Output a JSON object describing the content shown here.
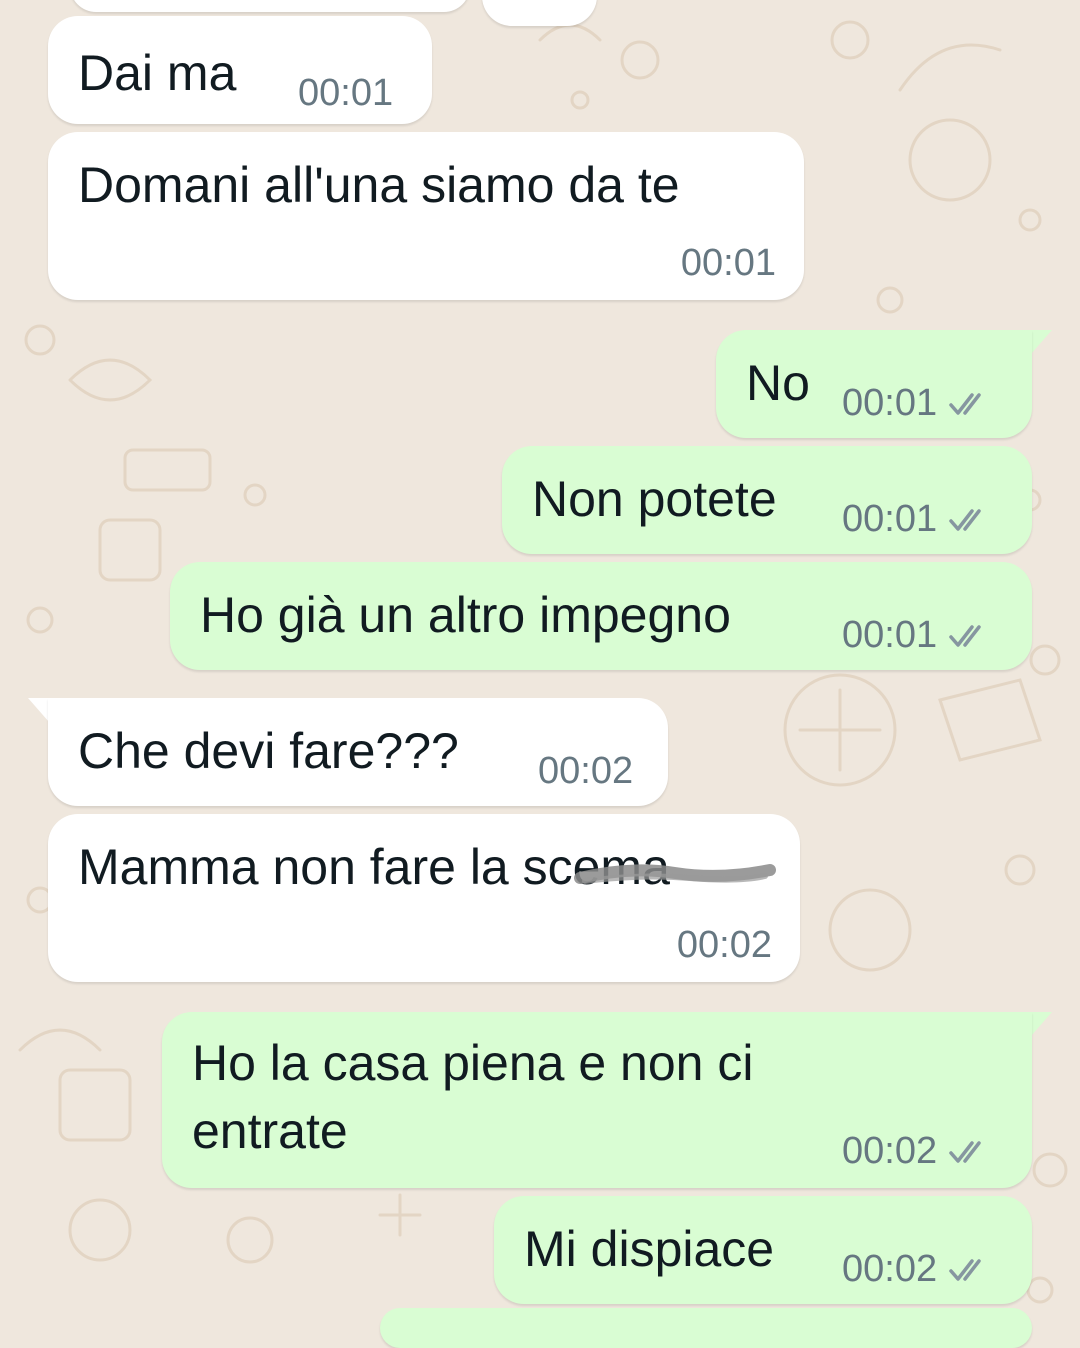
{
  "messages": [
    {
      "id": "m1",
      "direction": "in",
      "text": "Dai ma",
      "time": "00:01"
    },
    {
      "id": "m2",
      "direction": "in",
      "text": "Domani all'una siamo da te",
      "time": "00:01"
    },
    {
      "id": "m3",
      "direction": "out",
      "text": "No",
      "time": "00:01",
      "status": "delivered"
    },
    {
      "id": "m4",
      "direction": "out",
      "text": "Non potete",
      "time": "00:01",
      "status": "delivered"
    },
    {
      "id": "m5",
      "direction": "out",
      "text": "Ho già un altro impegno",
      "time": "00:01",
      "status": "delivered"
    },
    {
      "id": "m6",
      "direction": "in",
      "text": "Che devi fare???",
      "time": "00:02"
    },
    {
      "id": "m7",
      "direction": "in",
      "text": "Mamma non fare la scema",
      "time": "00:02",
      "redacted_word": "scema"
    },
    {
      "id": "m8",
      "direction": "out",
      "text_line1": "Ho la casa piena e non ci",
      "text_line2": "entrate",
      "time": "00:02",
      "status": "delivered"
    },
    {
      "id": "m9",
      "direction": "out",
      "text": "Mi dispiace",
      "time": "00:02",
      "status": "delivered"
    }
  ],
  "theme": {
    "incoming_bubble": "#ffffff",
    "outgoing_bubble": "#d9fdd3",
    "wallpaper": "#efe7dd",
    "meta_color": "#667781",
    "tick_color": "#8696a0"
  },
  "icons": {
    "status_tick": "double-check-icon"
  }
}
